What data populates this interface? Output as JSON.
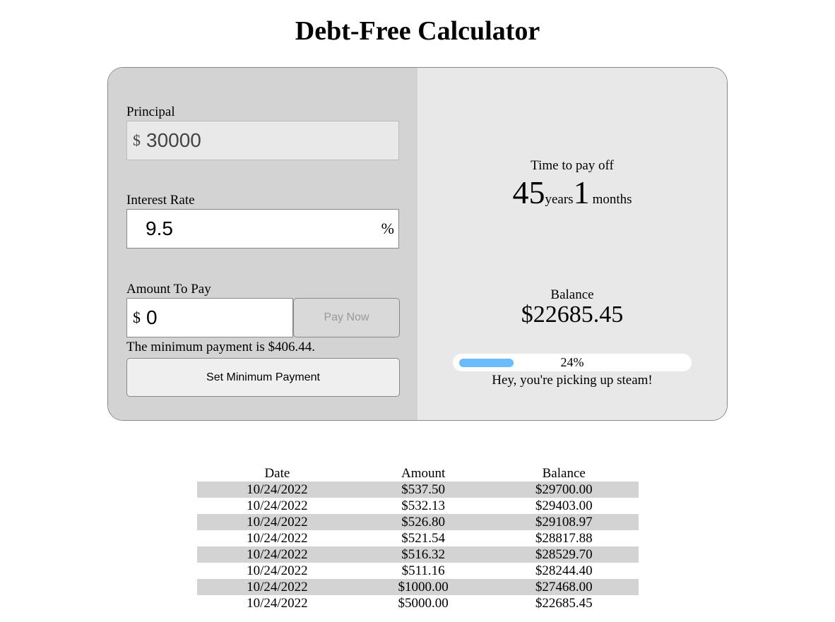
{
  "title": "Debt-Free Calculator",
  "form": {
    "principal_label": "Principal",
    "principal_currency": "$",
    "principal_value": "30000",
    "rate_label": "Interest Rate",
    "rate_value": "9.5",
    "rate_unit": "%",
    "amount_label": "Amount To Pay",
    "amount_currency": "$",
    "amount_value": "0",
    "pay_now": "Pay Now",
    "min_payment_text": "The minimum payment is $406.44.",
    "set_min": "Set Minimum Payment"
  },
  "results": {
    "time_label": "Time to pay off",
    "years": "45",
    "years_unit": "years",
    "months": "1",
    "months_unit": "months",
    "balance_label": "Balance",
    "balance": "$22685.45",
    "progress_percent": 24,
    "progress_label": "24%",
    "progress_color": "#6bbcfc",
    "message": "Hey, you're picking up steam!"
  },
  "table": {
    "headers": [
      "Date",
      "Amount",
      "Balance"
    ],
    "rows": [
      [
        "10/24/2022",
        "$537.50",
        "$29700.00"
      ],
      [
        "10/24/2022",
        "$532.13",
        "$29403.00"
      ],
      [
        "10/24/2022",
        "$526.80",
        "$29108.97"
      ],
      [
        "10/24/2022",
        "$521.54",
        "$28817.88"
      ],
      [
        "10/24/2022",
        "$516.32",
        "$28529.70"
      ],
      [
        "10/24/2022",
        "$511.16",
        "$28244.40"
      ],
      [
        "10/24/2022",
        "$1000.00",
        "$27468.00"
      ],
      [
        "10/24/2022",
        "$5000.00",
        "$22685.45"
      ]
    ]
  }
}
